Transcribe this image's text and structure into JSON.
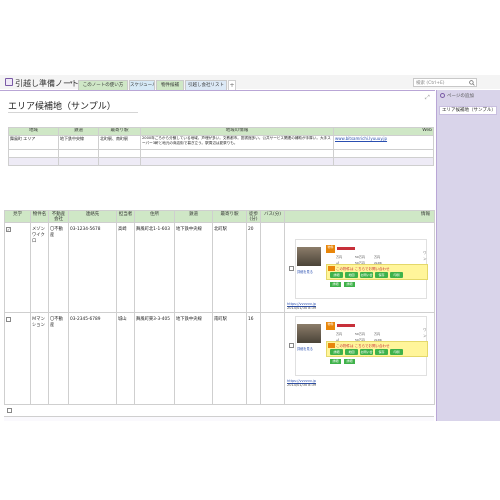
{
  "notebook": {
    "title": "引越し準備ノート",
    "caret": "▾"
  },
  "tabs": [
    {
      "label": "このノートの使い方",
      "color": "#cfe7c6"
    },
    {
      "label": "スケジュール",
      "color": "#d6eaf7"
    },
    {
      "label": "物件候補",
      "color": "#cfe7c6"
    },
    {
      "label": "引越し会社リスト",
      "color": "#dce9f6"
    }
  ],
  "tab_plus": "+",
  "search": {
    "placeholder": "検索 (Ctrl+E)"
  },
  "page": {
    "title": "エリア候補地（サンプル）",
    "expand_glyph": "⤢"
  },
  "right_panel": {
    "add_page": "ページの追加",
    "items": [
      "エリア候補地（サンプル）"
    ]
  },
  "area_table": {
    "headers": [
      "地域",
      "鉄道",
      "最寄り駅",
      "地域の情報",
      "Web"
    ],
    "rows": [
      {
        "region": "舞風町 エリア",
        "rail": "地下鉄中央線",
        "station": "北町駅、南町駅",
        "info": "2000年ごろから分譲している地域。芦埋が多い。文教都市。図書館多い。公共サービス関連の補助が手厚い。大手スーパー3軒と地元の商店街で暮ぎ立う。駅周辺は夏祭りも。",
        "web": "www.bitsamrichi.lyuuuy.jp"
      }
    ]
  },
  "property_table": {
    "headers": [
      "見学",
      "物件名",
      "不動産会社",
      "連絡先",
      "担当者",
      "住所",
      "鉄道",
      "最寄り駅",
      "徒歩(分)",
      "バス(分)",
      "情報"
    ],
    "rows": [
      {
        "checked": "✓",
        "name": "メゾン ワイクロ",
        "agency": "〇不動産",
        "phone": "03-1234-5678",
        "person": "高崎",
        "address": "舞風町北1-1-603",
        "rail": "地下鉄中央線",
        "station": "北町駅",
        "walk": "20",
        "bus": "",
        "card_link": "https://vvvvvv.jp",
        "card_date": "2014/01/30 8:39"
      },
      {
        "checked": "",
        "name": "Ｍマンション",
        "agency": "〇不動産",
        "phone": "03-2345-6789",
        "person": "城山",
        "address": "舞風町東3-3-405",
        "rail": "地下鉄中央線",
        "station": "南町駅",
        "walk": "16",
        "bus": "",
        "card_link": "https://vvvvvv.jp",
        "card_date": "2014/01/30 8:39"
      }
    ]
  },
  "card": {
    "badge": "物件",
    "yellow_text": "この物件は こちらでお問い合わせ",
    "buttons": [
      "詳細",
      "地図",
      "お問い合わせ",
      "保存",
      "印刷"
    ],
    "small_buttons": [
      "詳細",
      "詳細"
    ],
    "grid": [
      "万円",
      "50万円",
      "万円",
      "㎡",
      "50万円",
      "2LDK"
    ],
    "thumb_caption": "詳細を見る",
    "right_text": "ワン"
  },
  "colors": {
    "accent": "#7a5aa6",
    "header_green": "#cfe7c6",
    "panel": "#d9d4ea",
    "link": "#2a4fb0"
  },
  "icons": {
    "search": "search-icon",
    "notebook": "notebook-icon",
    "expand": "expand-icon",
    "add_page": "add-page-icon"
  }
}
